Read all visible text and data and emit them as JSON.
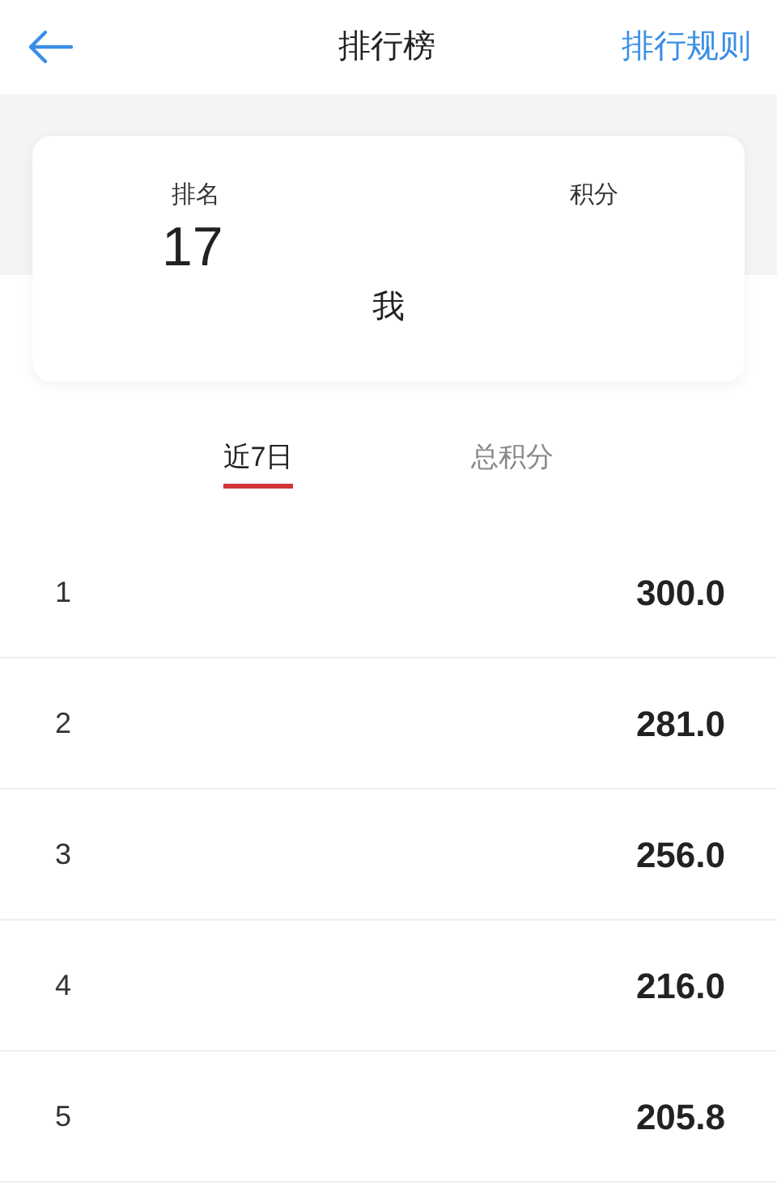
{
  "header": {
    "title": "排行榜",
    "rules_link": "排行规则"
  },
  "my_card": {
    "rank_label": "排名",
    "rank": "17",
    "score_label": "积分",
    "name": "我"
  },
  "tabs": [
    {
      "label": "近7日",
      "selected": true
    },
    {
      "label": "总积分",
      "selected": false
    }
  ],
  "rows": [
    {
      "rank": "1",
      "score": "300.0"
    },
    {
      "rank": "2",
      "score": "281.0"
    },
    {
      "rank": "3",
      "score": "256.0"
    },
    {
      "rank": "4",
      "score": "216.0"
    },
    {
      "rank": "5",
      "score": "205.8"
    }
  ]
}
